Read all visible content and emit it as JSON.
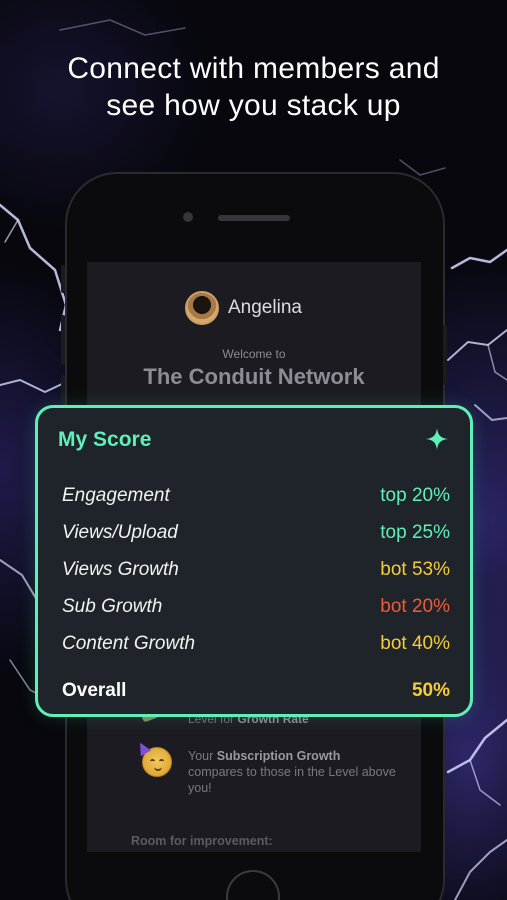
{
  "headline": {
    "line1": "Connect with members and",
    "line2": "see how you stack up"
  },
  "screen": {
    "user_name": "Angelina",
    "welcome_label": "Welcome to",
    "network_name": "The Conduit Network",
    "level_text_prefix": "Level for ",
    "level_text_bold": "Growth Rate",
    "sub_growth_prefix": "Your ",
    "sub_growth_bold": "Subscription Growth",
    "sub_growth_suffix": "compares to those in the Level above you!",
    "room_label": "Room for improvement:"
  },
  "score_card": {
    "title": "My Score",
    "icon": "sparkle-icon",
    "metrics": [
      {
        "label": "Engagement",
        "value": "top 20%",
        "color": "#5ff0b8"
      },
      {
        "label": "Views/Upload",
        "value": "top 25%",
        "color": "#5ff0b8"
      },
      {
        "label": "Views Growth",
        "value": "bot 53%",
        "color": "#f6cc3a"
      },
      {
        "label": "Sub Growth",
        "value": "bot 20%",
        "color": "#ef5b3a"
      },
      {
        "label": "Content Growth",
        "value": "bot 40%",
        "color": "#f6cc3a"
      }
    ],
    "overall_label": "Overall",
    "overall_value": "50%"
  },
  "colors": {
    "accent": "#5ff0b8",
    "warning": "#f6cc3a",
    "danger": "#ef5b3a"
  }
}
